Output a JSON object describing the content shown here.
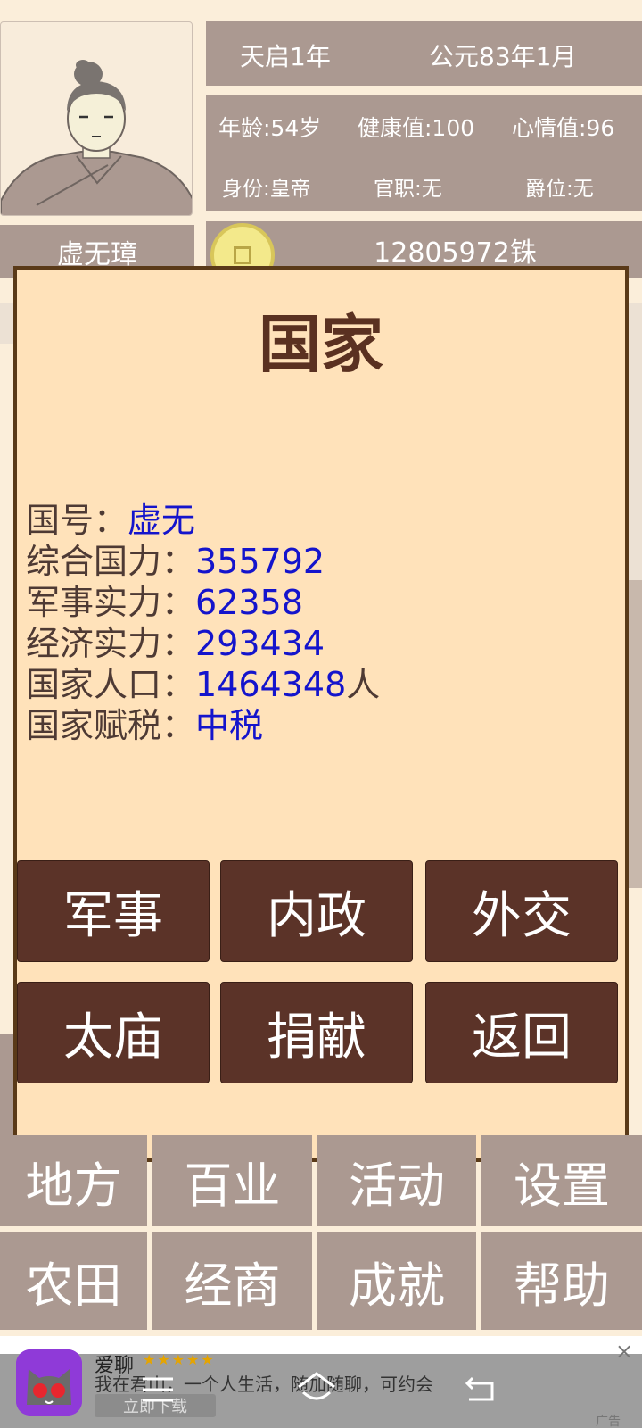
{
  "player": {
    "name": "虚无璋",
    "age": "年龄:54岁",
    "health": "健康值:100",
    "mood": "心情值:96",
    "identity": "身份:皇帝",
    "office": "官职:无",
    "title": "爵位:无",
    "money": "12805972铢"
  },
  "date": {
    "reign": "天启1年",
    "calendar": "公元83年1月"
  },
  "dialog": {
    "title": "国家",
    "rows": [
      {
        "label": "国号：",
        "value": "虚无",
        "suffix": ""
      },
      {
        "label": "综合国力：",
        "value": "355792",
        "suffix": ""
      },
      {
        "label": "军事实力：",
        "value": "62358",
        "suffix": ""
      },
      {
        "label": "经济实力：",
        "value": "293434",
        "suffix": ""
      },
      {
        "label": "国家人口：",
        "value": "1464348",
        "suffix": "人"
      },
      {
        "label": "国家赋税：",
        "value": "中税",
        "suffix": ""
      }
    ],
    "buttons": [
      "军事",
      "内政",
      "外交",
      "太庙",
      "捐献",
      "返回"
    ]
  },
  "menu": [
    "地方",
    "百业",
    "活动",
    "设置",
    "农田",
    "经商",
    "成就",
    "帮助"
  ],
  "ad": {
    "title": "爱聊",
    "stars": "★★★★★",
    "desc": "我在君山，一个人生活，随加随聊，可约会",
    "download": "立即下载",
    "tag": "广告",
    "close": "×"
  },
  "colors": {
    "page_bg": "#fbeeda",
    "panel": "#ab9991",
    "dialog_bg": "#ffe2ba",
    "dialog_border": "#5a3a18",
    "button": "#5b3328",
    "value_text": "#1414cc",
    "title_text": "#5a3121"
  }
}
